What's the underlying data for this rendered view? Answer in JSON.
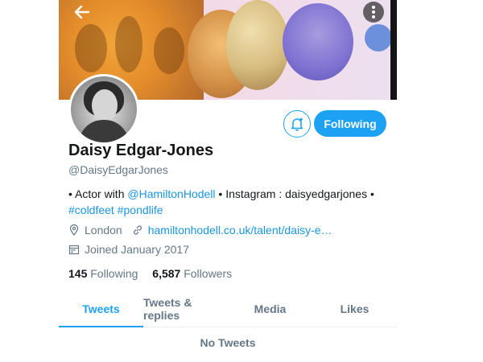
{
  "header": {
    "back_icon": "back-arrow-icon",
    "more_icon": "more-options-icon"
  },
  "profile": {
    "name": "Daisy Edgar-Jones",
    "handle": "@DaisyEdgarJones",
    "bio": {
      "part1": "• Actor with ",
      "mention": "@HamiltonHodell",
      "part2": " • Instagram : daisyedgarjones •",
      "hashtag1": "#coldfeet",
      "hashtag2": "#pondlife"
    },
    "location": "London",
    "website": "hamiltonhodell.co.uk/talent/daisy-e…",
    "joined": "Joined January 2017"
  },
  "actions": {
    "notify_icon": "bell-plus-icon",
    "following_label": "Following"
  },
  "stats": {
    "following_count": "145",
    "following_label": "Following",
    "followers_count": "6,587",
    "followers_label": "Followers"
  },
  "tabs": [
    {
      "label": "Tweets",
      "active": true
    },
    {
      "label": "Tweets & replies",
      "active": false
    },
    {
      "label": "Media",
      "active": false
    },
    {
      "label": "Likes",
      "active": false
    }
  ],
  "empty_state": "No Tweets",
  "colors": {
    "accent": "#1da1f2",
    "link": "#1b95e0",
    "secondary_text": "#657786"
  }
}
